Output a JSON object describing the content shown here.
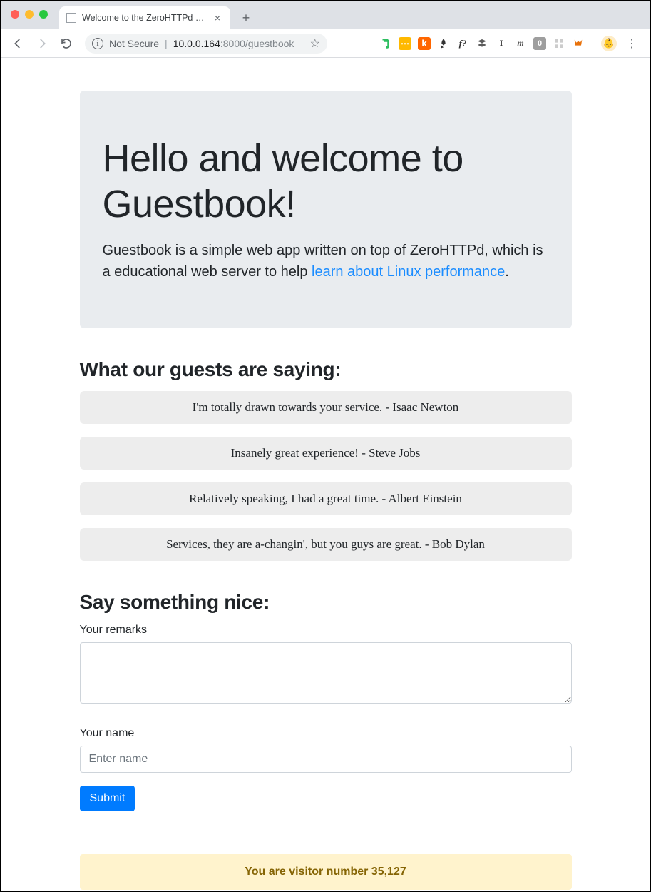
{
  "browser": {
    "tab_title": "Welcome to the ZeroHTTPd Gu",
    "not_secure_label": "Not Secure",
    "url_host": "10.0.0.164",
    "url_port_path": ":8000/guestbook"
  },
  "jumbotron": {
    "title": "Hello and welcome to Guestbook!",
    "lead_pre": "Guestbook is a simple web app written on top of ZeroHTTPd, which is a educational web server to help ",
    "lead_link": "learn about Linux performance",
    "lead_post": "."
  },
  "guests": {
    "heading": "What our guests are saying:",
    "items": [
      "I'm totally drawn towards your service. - Isaac Newton",
      "Insanely great experience! - Steve Jobs",
      "Relatively speaking, I had a great time. - Albert Einstein",
      "Services, they are a-changin', but you guys are great. - Bob Dylan"
    ]
  },
  "form": {
    "heading": "Say something nice:",
    "remarks_label": "Your remarks",
    "name_label": "Your name",
    "name_placeholder": "Enter name",
    "submit_label": "Submit"
  },
  "visitor": {
    "text": "You are visitor number 35,127"
  }
}
